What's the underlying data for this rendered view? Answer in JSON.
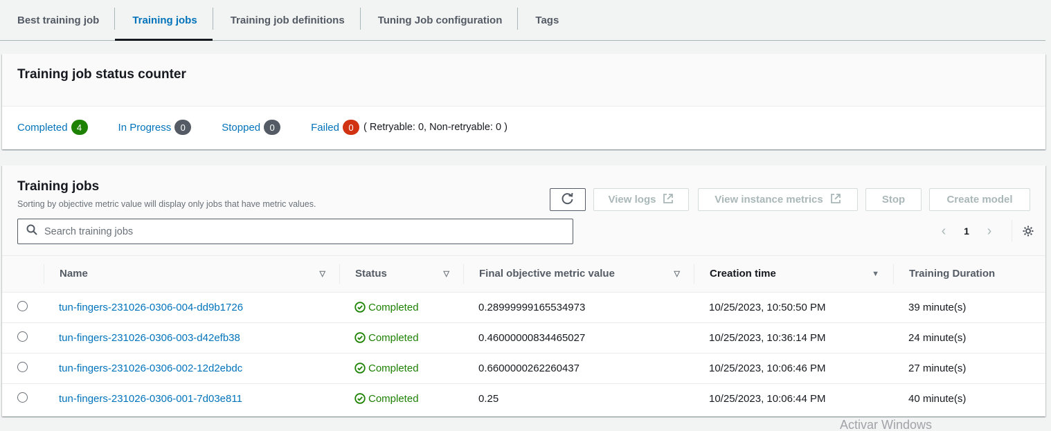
{
  "tabs": [
    {
      "label": "Best training job",
      "active": false
    },
    {
      "label": "Training jobs",
      "active": true
    },
    {
      "label": "Training job definitions",
      "active": false
    },
    {
      "label": "Tuning Job configuration",
      "active": false
    },
    {
      "label": "Tags",
      "active": false
    }
  ],
  "status_counter": {
    "title": "Training job status counter",
    "items": [
      {
        "label": "Completed",
        "count": "4",
        "color": "#1d8102"
      },
      {
        "label": "In Progress",
        "count": "0",
        "color": "#545b64"
      },
      {
        "label": "Stopped",
        "count": "0",
        "color": "#545b64"
      },
      {
        "label": "Failed",
        "count": "0",
        "color": "#d13212"
      }
    ],
    "failed_detail": "( Retryable: 0, Non-retryable: 0 )"
  },
  "jobs": {
    "title": "Training jobs",
    "description": "Sorting by objective metric value will display only jobs that have metric values.",
    "search_placeholder": "Search training jobs",
    "buttons": {
      "refresh_icon": "refresh-icon",
      "view_logs": "View logs",
      "view_instance_metrics": "View instance metrics",
      "stop": "Stop",
      "create_model": "Create model"
    },
    "pagination": {
      "current_page": "1"
    },
    "columns": [
      "Name",
      "Status",
      "Final objective metric value",
      "Creation time",
      "Training Duration"
    ],
    "sorted_column": "Creation time",
    "rows": [
      {
        "name": "tun-fingers-231026-0306-004-dd9b1726",
        "status": "Completed",
        "metric": "0.28999999165534973",
        "created": "10/25/2023, 10:50:50 PM",
        "duration": "39 minute(s)"
      },
      {
        "name": "tun-fingers-231026-0306-003-d42efb38",
        "status": "Completed",
        "metric": "0.46000000834465027",
        "created": "10/25/2023, 10:36:14 PM",
        "duration": "24 minute(s)"
      },
      {
        "name": "tun-fingers-231026-0306-002-12d2ebdc",
        "status": "Completed",
        "metric": "0.6600000262260437",
        "created": "10/25/2023, 10:06:46 PM",
        "duration": "27 minute(s)"
      },
      {
        "name": "tun-fingers-231026-0306-001-7d03e811",
        "status": "Completed",
        "metric": "0.25",
        "created": "10/25/2023, 10:06:44 PM",
        "duration": "40 minute(s)"
      }
    ]
  },
  "watermark": "Activar Windows"
}
